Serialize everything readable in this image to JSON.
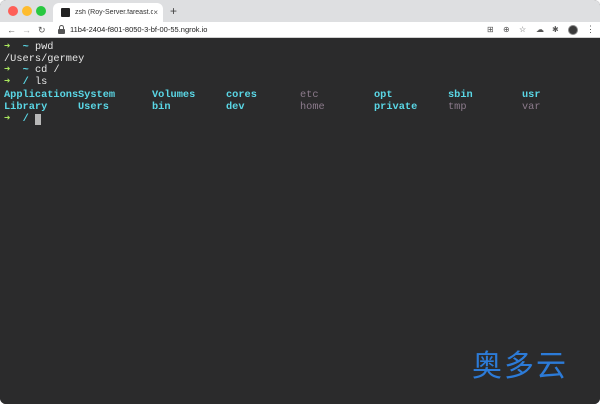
{
  "browser": {
    "tab_title": "zsh (Roy-Server.fareast.corp.microsoft.com)",
    "tab_close": "×",
    "new_tab": "+",
    "url": "11b4-2404-f801-8050-3-bf-00-55.ngrok.io",
    "icons": [
      "back-arrow-icon",
      "forward-arrow-icon",
      "reload-icon",
      "lock-icon",
      "translate-icon",
      "zoom-icon",
      "star-icon",
      "cloud-icon",
      "puzzle-icon",
      "avatar",
      "menu-dots-icon"
    ]
  },
  "terminal": {
    "arrow": "➜",
    "lines": [
      {
        "dir": "~",
        "cmd": "pwd"
      },
      {
        "output": "/Users/germey"
      },
      {
        "dir": "~",
        "cmd": "cd /"
      },
      {
        "dir": "/",
        "cmd": "ls"
      }
    ],
    "ls_row1": [
      "Applications",
      "System",
      "Volumes",
      "cores",
      "etc",
      "opt",
      "sbin",
      "usr"
    ],
    "ls_row2": [
      "Library",
      "Users",
      "bin",
      "dev",
      "home",
      "private",
      "tmp",
      "var"
    ],
    "final_prompt_dir": "/"
  },
  "watermark": "奥多云",
  "colors": {
    "prompt_arrow": "#a8e65d",
    "directory": "#5ad7e6",
    "symlink": "#8c7b8c",
    "background": "#2b2b2c",
    "watermark": "#2c7bd8"
  }
}
